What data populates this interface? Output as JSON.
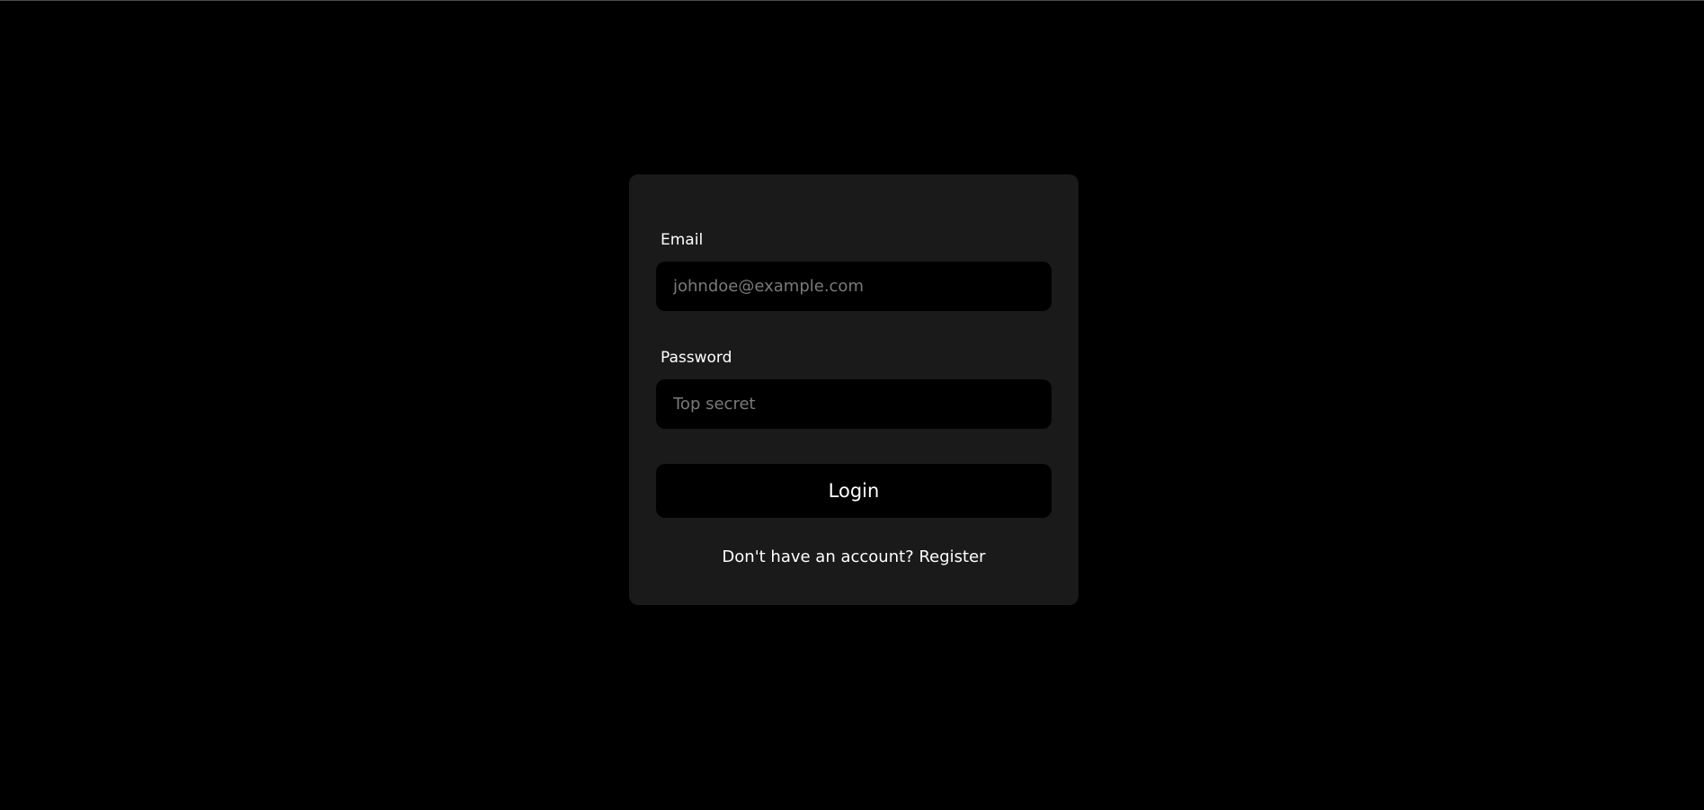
{
  "login_form": {
    "email_label": "Email",
    "email_placeholder": "johndoe@example.com",
    "password_label": "Password",
    "password_placeholder": "Top secret",
    "submit_label": "Login",
    "register_prompt": "Don't have an account?",
    "register_link": "Register"
  },
  "colors": {
    "background": "#000000",
    "card": "#1a1a1a",
    "input": "#000000",
    "text": "#ffffff",
    "placeholder": "#7a7a7a"
  }
}
